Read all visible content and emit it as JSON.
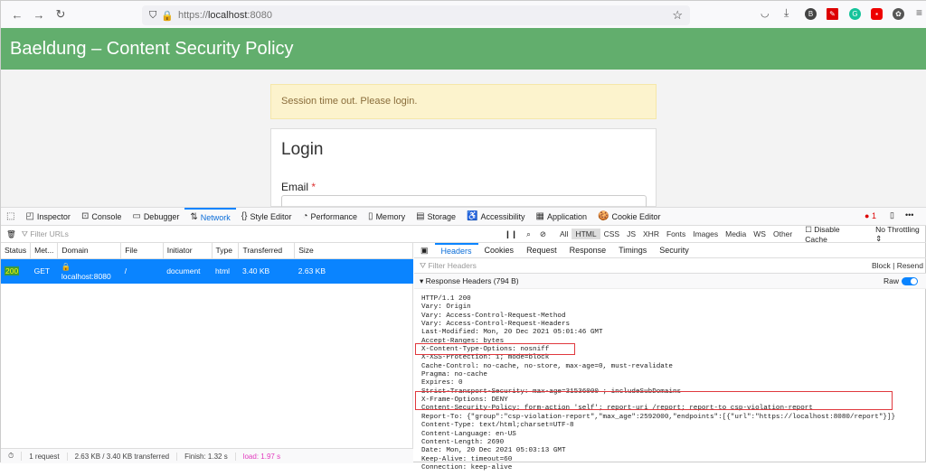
{
  "browser": {
    "url_scheme": "https://",
    "url_host": "localhost",
    "url_port": ":8080",
    "icons": [
      "back-icon",
      "forward-icon",
      "reload-icon",
      "shield-icon",
      "lock-icon",
      "star-icon",
      "pocket-icon",
      "download-icon",
      "extension-icon",
      "menu-icon"
    ],
    "extension_badge": "B",
    "error_count": "1"
  },
  "app": {
    "title": "Baeldung – Content Security Policy",
    "alert": "Session time out. Please login.",
    "login_title": "Login",
    "email_label": "Email",
    "required_mark": "*"
  },
  "devtools": {
    "tabs": [
      "Inspector",
      "Console",
      "Debugger",
      "Network",
      "Style Editor",
      "Performance",
      "Memory",
      "Storage",
      "Accessibility",
      "Application",
      "Cookie Editor"
    ],
    "active_tab": "Network",
    "filter_placeholder": "Filter URLs",
    "types": [
      "All",
      "HTML",
      "CSS",
      "JS",
      "XHR",
      "Fonts",
      "Images",
      "Media",
      "WS",
      "Other"
    ],
    "active_type": "HTML",
    "disable_cache": "Disable Cache",
    "throttling": "No Throttling",
    "columns": [
      "Status",
      "Met...",
      "Domain",
      "File",
      "Initiator",
      "Type",
      "Transferred",
      "Size"
    ],
    "rows": [
      {
        "status": "200",
        "method": "GET",
        "domain": "localhost:8080",
        "file": "/",
        "initiator": "document",
        "type": "html",
        "transferred": "3.40 KB",
        "size": "2.63 KB"
      }
    ],
    "detail_tabs": [
      "Headers",
      "Cookies",
      "Request",
      "Response",
      "Timings",
      "Security"
    ],
    "active_detail_tab": "Headers",
    "filter_headers_placeholder": "Filter Headers",
    "block": "Block",
    "resend": "Resend",
    "section": "Response Headers (794 B)",
    "raw_label": "Raw",
    "raw_enabled": true,
    "headers": [
      "HTTP/1.1 200",
      "Vary: Origin",
      "Vary: Access-Control-Request-Method",
      "Vary: Access-Control-Request-Headers",
      "Last-Modified: Mon, 20 Dec 2021 05:01:46 GMT",
      "Accept-Ranges: bytes",
      "X-Content-Type-Options: nosniff",
      "X-XSS-Protection: 1; mode=block",
      "Cache-Control: no-cache, no-store, max-age=0, must-revalidate",
      "Pragma: no-cache",
      "Expires: 0",
      "Strict-Transport-Security: max-age=31536000 ; includeSubDomains",
      "X-Frame-Options: DENY",
      "Content-Security-Policy: form-action 'self'; report-uri /report; report-to csp-violation-report",
      "Report-To: {\"group\":\"csp-violation-report\",\"max_age\":2592000,\"endpoints\":[{\"url\":\"https://localhost:8080/report\"}]}",
      "Content-Type: text/html;charset=UTF-8",
      "Content-Language: en-US",
      "Content-Length: 2690",
      "Date: Mon, 20 Dec 2021 05:03:13 GMT",
      "Keep-Alive: timeout=60",
      "Connection: keep-alive"
    ],
    "status": {
      "requests": "1 request",
      "transferred": "2.63 KB / 3.40 KB transferred",
      "finish": "Finish: 1.32 s",
      "load": "load: 1.97 s"
    },
    "highlight_color": "#e0393e",
    "accent": "#0a84ff"
  }
}
